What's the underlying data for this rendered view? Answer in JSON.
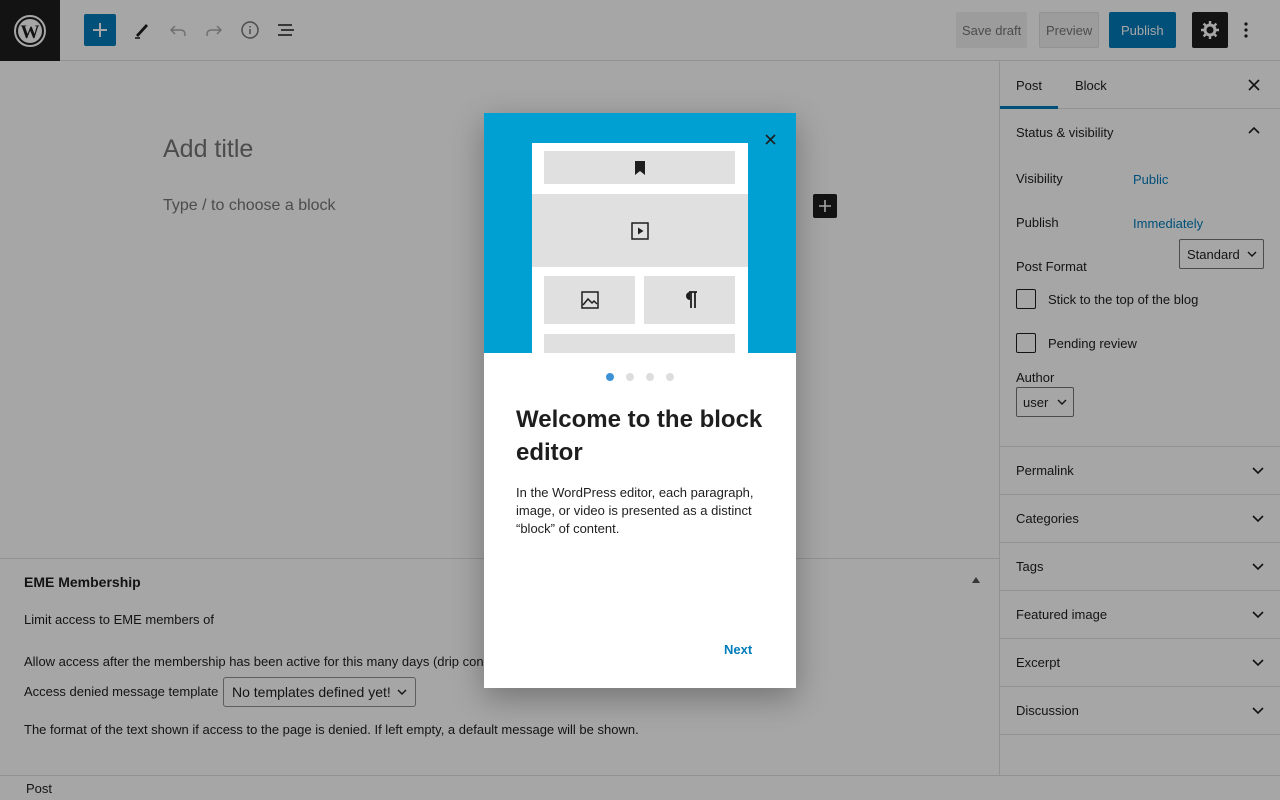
{
  "toolbar": {
    "save_draft_label": "Save draft",
    "preview_label": "Preview",
    "publish_label": "Publish"
  },
  "editor": {
    "title_placeholder": "Add title",
    "block_placeholder": "Type / to choose a block"
  },
  "metabox": {
    "title": "EME Membership",
    "limit_text": "Limit access to EME members of",
    "drip_text": "Allow access after the membership has been active for this many days (drip con",
    "denied_label": "Access denied message template",
    "denied_select_value": "No templates defined yet!",
    "format_text": "The format of the text shown if access to the page is denied. If left empty, a default message will be shown."
  },
  "footer": {
    "breadcrumb": "Post"
  },
  "sidebar": {
    "tabs": [
      {
        "label": "Post"
      },
      {
        "label": "Block"
      }
    ],
    "status": {
      "heading": "Status & visibility",
      "visibility_label": "Visibility",
      "visibility_value": "Public",
      "publish_label": "Publish",
      "publish_value": "Immediately",
      "format_label": "Post Format",
      "format_value": "Standard",
      "sticky_label": "Stick to the top of the blog",
      "pending_label": "Pending review",
      "author_label": "Author",
      "author_value": "user"
    },
    "panels": [
      {
        "label": "Permalink"
      },
      {
        "label": "Categories"
      },
      {
        "label": "Tags"
      },
      {
        "label": "Featured image"
      },
      {
        "label": "Excerpt"
      },
      {
        "label": "Discussion"
      }
    ]
  },
  "modal": {
    "title": "Welcome to the block editor",
    "body": "In the WordPress editor, each paragraph, image, or video is presented as a distinct “block” of content.",
    "next_label": "Next",
    "page_count": 4,
    "current_page": 1
  },
  "colors": {
    "accent": "#007cba",
    "hero": "#00a0d2",
    "dark": "#1e1e1e"
  }
}
